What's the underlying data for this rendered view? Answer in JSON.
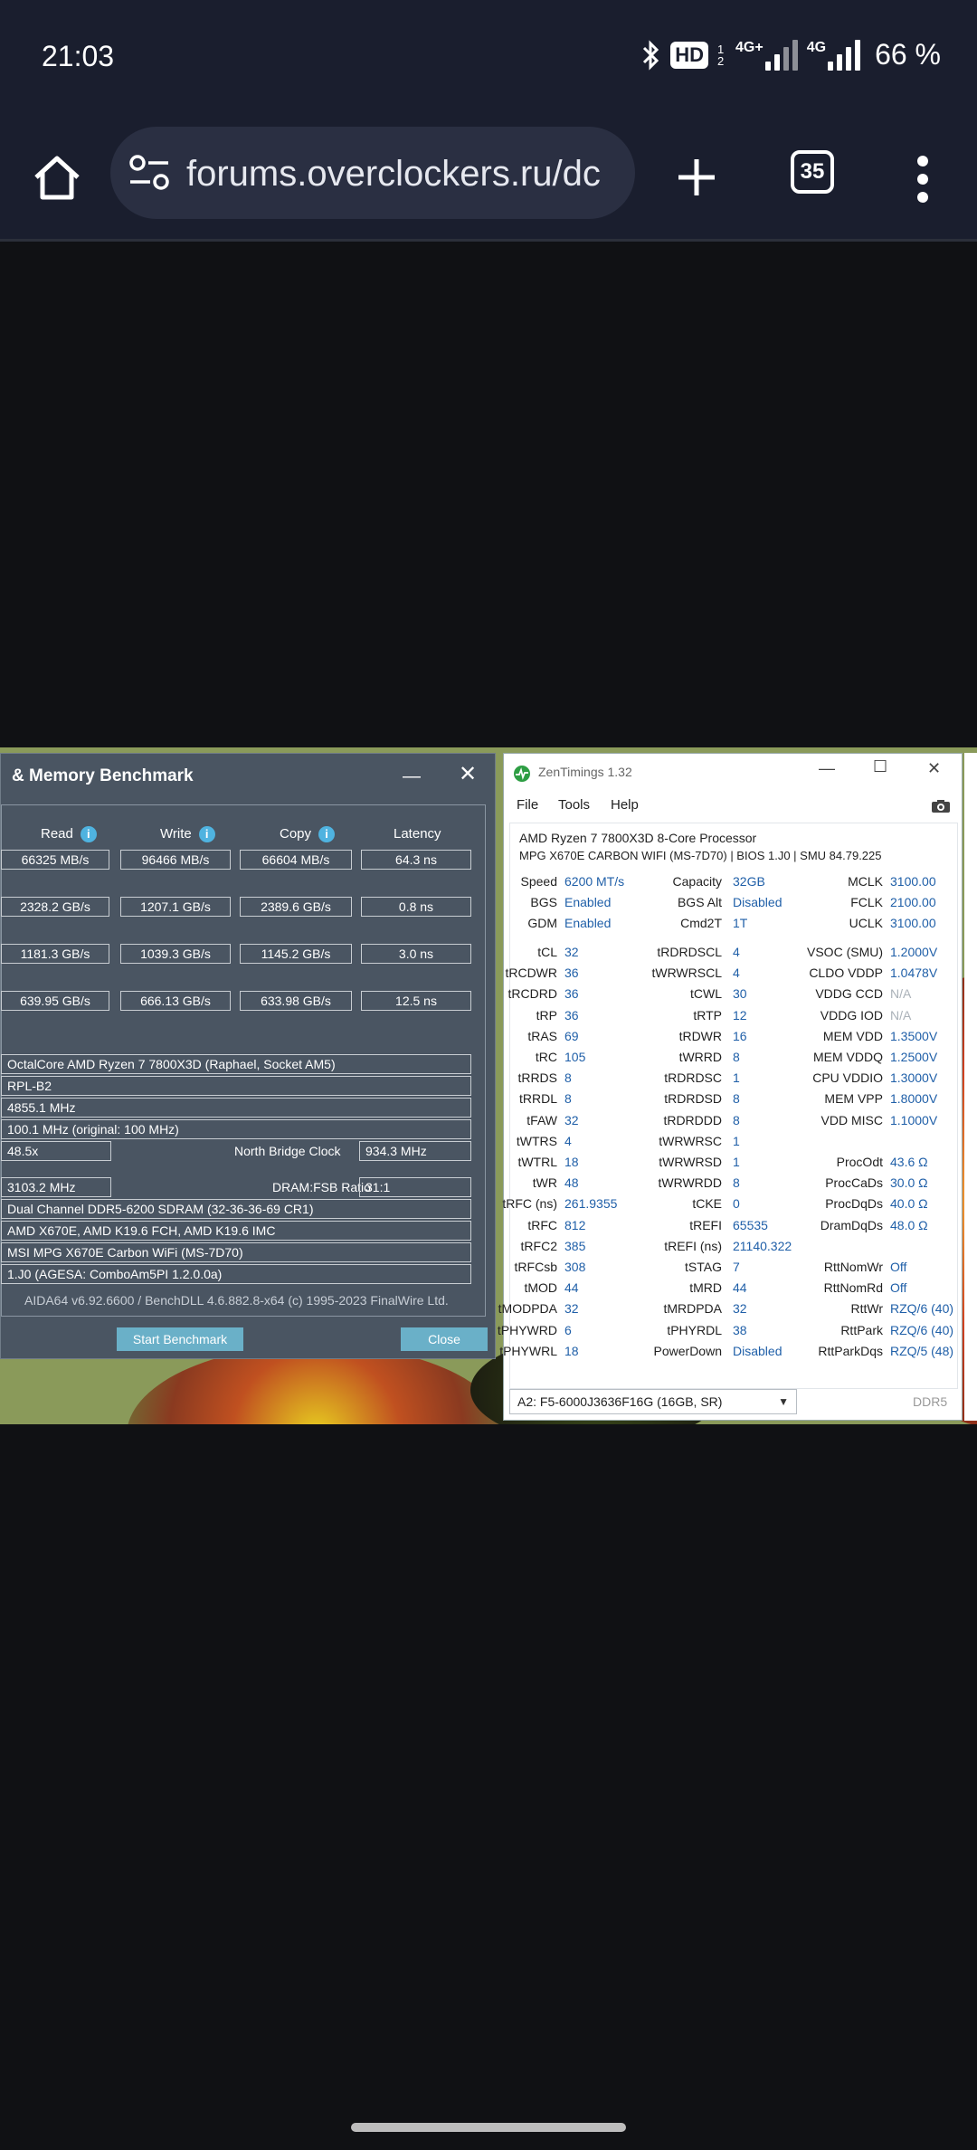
{
  "status": {
    "time": "21:03",
    "battery": "66 %",
    "net1": "4G+",
    "net2": "4G",
    "hd": "HD",
    "hd_sub": "1 2"
  },
  "browser": {
    "url": "forums.overclockers.ru/dc",
    "tab_count": "35"
  },
  "aida": {
    "title": "& Memory Benchmark",
    "headers": {
      "read": "Read",
      "write": "Write",
      "copy": "Copy",
      "latency": "Latency"
    },
    "rows": [
      [
        "66325 MB/s",
        "96466 MB/s",
        "66604 MB/s",
        "64.3 ns"
      ],
      [
        "2328.2 GB/s",
        "1207.1 GB/s",
        "2389.6 GB/s",
        "0.8 ns"
      ],
      [
        "1181.3 GB/s",
        "1039.3 GB/s",
        "1145.2 GB/s",
        "3.0 ns"
      ],
      [
        "639.95 GB/s",
        "666.13 GB/s",
        "633.98 GB/s",
        "12.5 ns"
      ]
    ],
    "cpu": "OctalCore AMD Ryzen 7 7800X3D  (Raphael, Socket AM5)",
    "stepping": "RPL-B2",
    "clock": "4855.1 MHz",
    "bus": "100.1 MHz  (original: 100 MHz)",
    "multiplier": "48.5x",
    "nb_label": "North Bridge Clock",
    "nb_value": "934.3 MHz",
    "mem_clock": "3103.2 MHz",
    "ratio_label": "DRAM:FSB Ratio",
    "ratio_value": "31:1",
    "mem_type": "Dual Channel DDR5-6200 SDRAM  (32-36-36-69 CR1)",
    "chipset": "AMD X670E, AMD K19.6 FCH, AMD K19.6 IMC",
    "board": "MSI MPG X670E Carbon WiFi (MS-7D70)",
    "bios": "1.J0  (AGESA: ComboAm5PI 1.2.0.0a)",
    "footer": "AIDA64 v6.92.6600 / BenchDLL 4.6.882.8-x64  (c) 1995-2023 FinalWire Ltd.",
    "start_btn": "Start Benchmark",
    "close_btn": "Close",
    "info_glyph": "i"
  },
  "zen": {
    "title": "ZenTimings 1.32",
    "menu": [
      "File",
      "Tools",
      "Help"
    ],
    "cpu": "AMD Ryzen 7 7800X3D 8-Core Processor",
    "board": "MPG X670E CARBON WIFI (MS-7D70) | BIOS 1.J0 | SMU 84.79.225",
    "top": [
      [
        "Speed",
        "6200 MT/s",
        "Capacity",
        "32GB",
        "MCLK",
        "3100.00"
      ],
      [
        "BGS",
        "Enabled",
        "BGS Alt",
        "Disabled",
        "FCLK",
        "2100.00"
      ],
      [
        "GDM",
        "Enabled",
        "Cmd2T",
        "1T",
        "UCLK",
        "3100.00"
      ]
    ],
    "timings": [
      [
        "tCL",
        "32",
        "tRDRDSCL",
        "4",
        "VSOC (SMU)",
        "1.2000V"
      ],
      [
        "tRCDWR",
        "36",
        "tWRWRSCL",
        "4",
        "CLDO VDDP",
        "1.0478V"
      ],
      [
        "tRCDRD",
        "36",
        "tCWL",
        "30",
        "VDDG CCD",
        "N/A"
      ],
      [
        "tRP",
        "36",
        "tRTP",
        "12",
        "VDDG IOD",
        "N/A"
      ],
      [
        "tRAS",
        "69",
        "tRDWR",
        "16",
        "MEM VDD",
        "1.3500V"
      ],
      [
        "tRC",
        "105",
        "tWRRD",
        "8",
        "MEM VDDQ",
        "1.2500V"
      ],
      [
        "tRRDS",
        "8",
        "tRDRDSC",
        "1",
        "CPU VDDIO",
        "1.3000V"
      ],
      [
        "tRRDL",
        "8",
        "tRDRDSD",
        "8",
        "MEM VPP",
        "1.8000V"
      ],
      [
        "tFAW",
        "32",
        "tRDRDDD",
        "8",
        "VDD MISC",
        "1.1000V"
      ],
      [
        "tWTRS",
        "4",
        "tWRWRSC",
        "1",
        "",
        ""
      ],
      [
        "tWTRL",
        "18",
        "tWRWRSD",
        "1",
        "ProcOdt",
        "43.6 Ω"
      ],
      [
        "tWR",
        "48",
        "tWRWRDD",
        "8",
        "ProcCaDs",
        "30.0 Ω"
      ],
      [
        "tRFC (ns)",
        "261.9355",
        "tCKE",
        "0",
        "ProcDqDs",
        "40.0 Ω"
      ],
      [
        "tRFC",
        "812",
        "tREFI",
        "65535",
        "DramDqDs",
        "48.0 Ω"
      ],
      [
        "tRFC2",
        "385",
        "tREFI (ns)",
        "21140.322",
        "",
        ""
      ],
      [
        "tRFCsb",
        "308",
        "tSTAG",
        "7",
        "RttNomWr",
        "Off"
      ],
      [
        "tMOD",
        "44",
        "tMRD",
        "44",
        "RttNomRd",
        "Off"
      ],
      [
        "tMODPDA",
        "32",
        "tMRDPDA",
        "32",
        "RttWr",
        "RZQ/6 (40)"
      ],
      [
        "tPHYWRD",
        "6",
        "tPHYRDL",
        "38",
        "RttPark",
        "RZQ/6 (40)"
      ],
      [
        "tPHYWRL",
        "18",
        "PowerDown",
        "Disabled",
        "RttParkDqs",
        "RZQ/5 (48)"
      ]
    ],
    "dim_values": [
      "N/A"
    ],
    "module": "A2: F5-6000J3636F16G (16GB, SR)",
    "ddr": "DDR5"
  }
}
